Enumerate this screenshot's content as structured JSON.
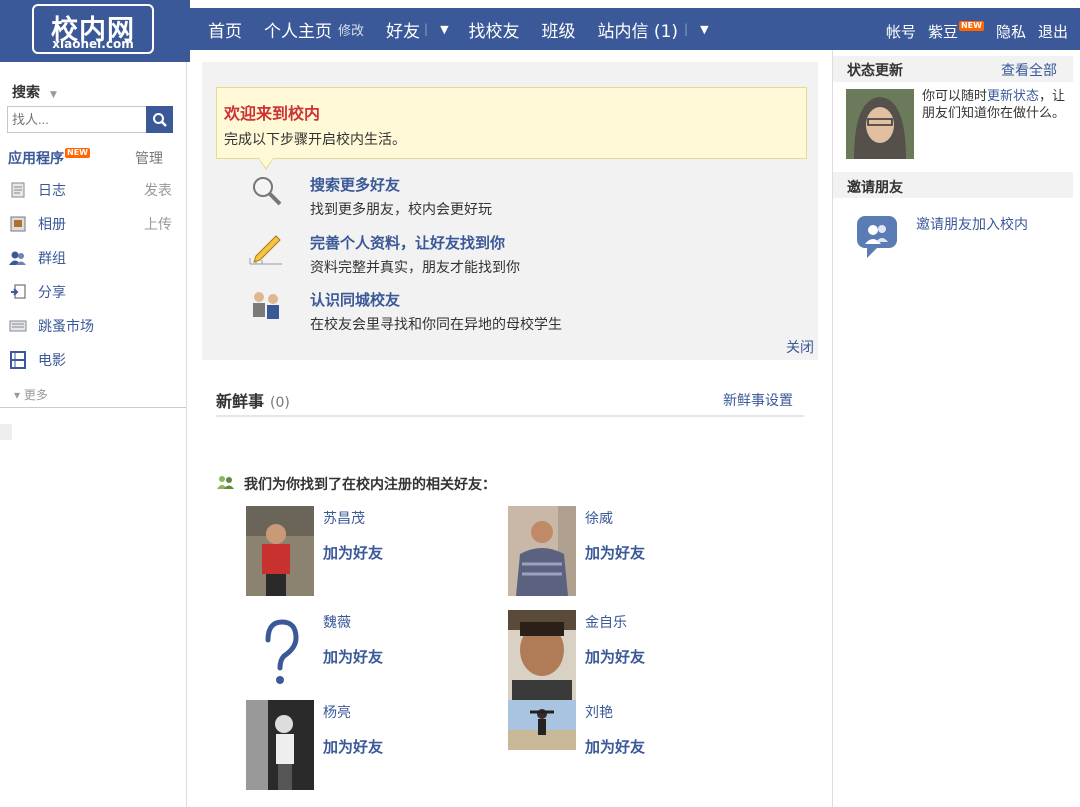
{
  "header": {
    "logo_cn": "校内网",
    "logo_en": "xiaonei.com",
    "nav": {
      "home": "首页",
      "profile": "个人主页",
      "edit": "修改",
      "friends": "好友",
      "find_alumni": "找校友",
      "class": "班级",
      "messages": "站内信 (1)"
    },
    "right": {
      "account": "帐号",
      "beans": "紫豆",
      "new_badge": "NEW",
      "privacy": "隐私",
      "logout": "退出"
    }
  },
  "sidebar": {
    "search_title": "搜索",
    "search_placeholder": "找人...",
    "apps_title": "应用程序",
    "apps_new_badge": "NEW",
    "apps_manage": "管理",
    "apps": [
      {
        "label": "日志",
        "action": "发表",
        "icon": "journal-icon"
      },
      {
        "label": "相册",
        "action": "上传",
        "icon": "photo-album-icon"
      },
      {
        "label": "群组",
        "action": "",
        "icon": "group-icon"
      },
      {
        "label": "分享",
        "action": "",
        "icon": "share-icon"
      },
      {
        "label": "跳蚤市场",
        "action": "",
        "icon": "flea-market-icon"
      },
      {
        "label": "电影",
        "action": "",
        "icon": "movie-icon"
      }
    ],
    "more": "▾ 更多"
  },
  "welcome": {
    "title": "欢迎来到校内",
    "subtitle": "完成以下步骤开启校内生活。",
    "steps": [
      {
        "title": "搜索更多好友",
        "desc": "找到更多朋友，校内会更好玩",
        "icon": "magnifier-icon"
      },
      {
        "title": "完善个人资料，让好友找到你",
        "desc": "资料完整并真实，朋友才能找到你",
        "icon": "pencil-icon"
      },
      {
        "title": "认识同城校友",
        "desc": "在校友会里寻找和你同在异地的母校学生",
        "icon": "alumni-icon"
      }
    ],
    "close": "关闭"
  },
  "news": {
    "title": "新鲜事",
    "count": "(0)",
    "settings": "新鲜事设置",
    "found_text": "我们为你找到了在校内注册的相关好友：",
    "add_label": "加为好友",
    "friends": [
      {
        "name": "苏昌茂"
      },
      {
        "name": "徐威"
      },
      {
        "name": "魏薇"
      },
      {
        "name": "金自乐"
      },
      {
        "name": "杨亮"
      },
      {
        "name": "刘艳"
      }
    ]
  },
  "right_panel": {
    "status_title": "状态更新",
    "view_all": "查看全部",
    "status_text_1": "你可以随时",
    "status_link": "更新状态",
    "status_text_2": "，让朋友们知道你在做什么。",
    "invite_title": "邀请朋友",
    "invite_link": "邀请朋友加入校内"
  }
}
